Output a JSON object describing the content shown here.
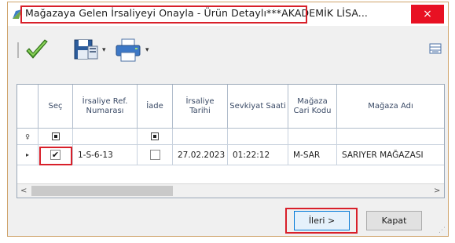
{
  "window": {
    "title": "Mağazaya Gelen İrsaliyeyi Onayla - Ürün Detaylı",
    "title_suffix": "***AKADEMİK LİSA...",
    "close_glyph": "×",
    "accent_highlight": "#d8202a"
  },
  "toolbar": {
    "icons": [
      "approve-check-icon",
      "save-icon",
      "print-icon",
      "column-chooser-icon"
    ],
    "dropdown_glyph": "▾"
  },
  "grid": {
    "columns": [
      "Seç",
      "İrsaliye Ref. Numarası",
      "İade",
      "İrsaliye Tarihi",
      "Sevkiyat Saati",
      "Mağaza Cari Kodu",
      "Mağaza Adı"
    ],
    "filter_row_glyph": "♀",
    "rows": [
      {
        "indicator": "▸",
        "selected": true,
        "ref_no": "1-S-6-13",
        "iade": false,
        "date": "27.02.2023",
        "time": "01:22:12",
        "store_code": "M-SAR",
        "store_name": "SARIYER MAĞAZASI"
      }
    ],
    "check_glyph": "✔",
    "scroll_left": "<",
    "scroll_right": ">"
  },
  "buttons": {
    "next_label": "İleri >",
    "close_label": "Kapat"
  }
}
